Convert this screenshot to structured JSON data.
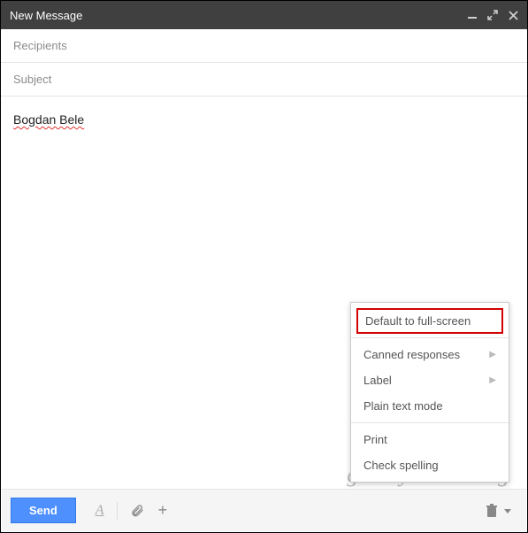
{
  "window": {
    "title": "New Message"
  },
  "fields": {
    "recipients_placeholder": "Recipients",
    "subject_placeholder": "Subject"
  },
  "body": {
    "signature": "Bogdan Bele"
  },
  "toolbar": {
    "send_label": "Send",
    "format_label": "A",
    "attach_label": "📎",
    "insert_label": "+"
  },
  "options_menu": {
    "default_fullscreen": "Default to full-screen",
    "canned_responses": "Canned responses",
    "label": "Label",
    "plain_text": "Plain text mode",
    "print": "Print",
    "check_spelling": "Check spelling"
  },
  "watermark": "groovyPublishing"
}
